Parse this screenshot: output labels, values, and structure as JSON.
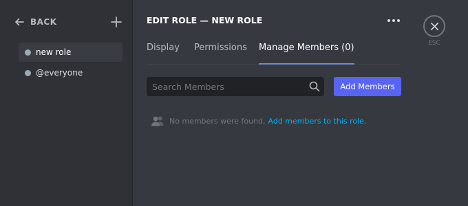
{
  "sidebar": {
    "back_label": "BACK",
    "roles": [
      {
        "name": "new role",
        "color": "#99aab5",
        "selected": true
      },
      {
        "name": "@everyone",
        "color": "#99aab5",
        "selected": false
      }
    ]
  },
  "header": {
    "title": "EDIT ROLE — NEW ROLE",
    "more_icon": "ellipsis-icon"
  },
  "tabs": [
    {
      "label": "Display",
      "active": false
    },
    {
      "label": "Permissions",
      "active": false
    },
    {
      "label": "Manage Members (0)",
      "active": true
    }
  ],
  "search": {
    "placeholder": "Search Members",
    "value": ""
  },
  "add_members_label": "Add Members",
  "empty_state": {
    "message": "No members were found.",
    "link": "Add members to this role."
  },
  "close": {
    "label": "ESC"
  },
  "colors": {
    "accent": "#5865f2",
    "tab_indicator": "#7289da",
    "link": "#00b0f4",
    "background": "#36393f",
    "sidebar": "#2f3136"
  }
}
